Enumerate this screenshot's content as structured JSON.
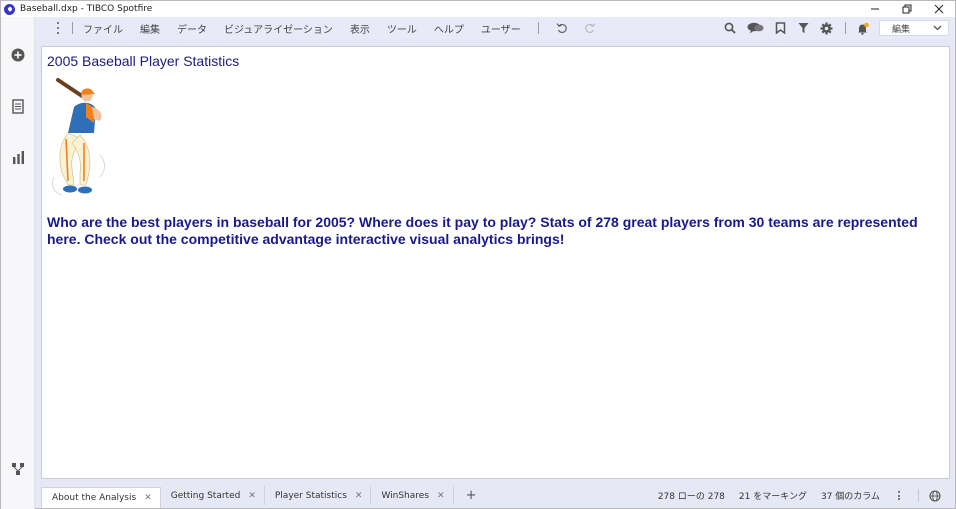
{
  "window": {
    "title": "Baseball.dxp - TIBCO Spotfire"
  },
  "menu": {
    "items": [
      "ファイル",
      "編集",
      "データ",
      "ビジュアライゼーション",
      "表示",
      "ツール",
      "ヘルプ",
      "ユーザー"
    ],
    "mode_select": "編集"
  },
  "page": {
    "title": "2005 Baseball Player Statistics",
    "intro": "Who are the best players in baseball for 2005? Where does it pay to play? Stats of 278 great players from 30 teams are represented here. Check out the competitive advantage interactive visual analytics brings!"
  },
  "tabs": [
    {
      "label": "About the Analysis",
      "active": true
    },
    {
      "label": "Getting Started",
      "active": false
    },
    {
      "label": "Player Statistics",
      "active": false
    },
    {
      "label": "WinShares",
      "active": false
    }
  ],
  "status": {
    "rows": "278 ローの 278",
    "marked": "21 をマーキング",
    "columns": "37 個のカラム"
  },
  "colors": {
    "title_text": "#1b1b80",
    "menubar_bg": "#e8ebf7",
    "accent": "#3a35c9"
  },
  "icons": [
    "add-icon",
    "pages-icon",
    "bar-chart-icon",
    "data-canvas-icon",
    "search-icon",
    "collaboration-icon",
    "bookmark-icon",
    "filter-icon",
    "settings-icon",
    "notifications-icon",
    "undo-icon",
    "redo-icon",
    "globe-icon"
  ]
}
